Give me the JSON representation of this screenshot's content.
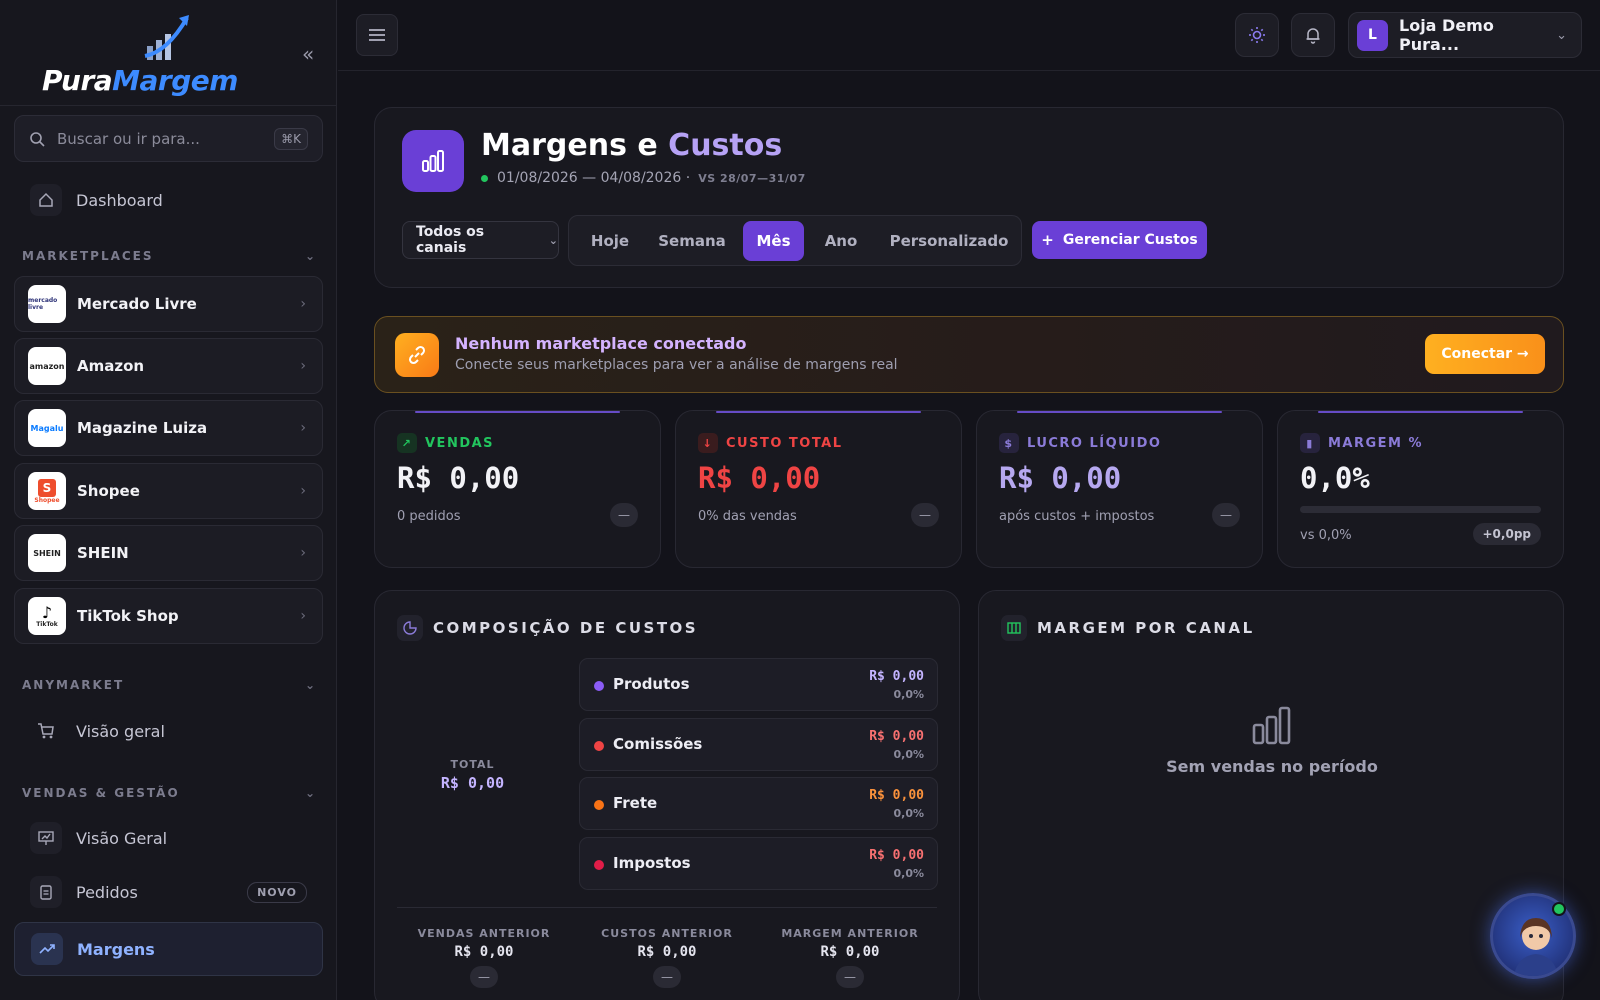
{
  "brand": {
    "part1": "Pura",
    "part2": "Margem"
  },
  "sidebar": {
    "search_placeholder": "Buscar ou ir para...",
    "search_shortcut": "⌘K",
    "dashboard": "Dashboard",
    "sections": {
      "marketplaces": "MARKETPLACES",
      "anymarket": "ANYMARKET",
      "vendas": "VENDAS & GESTÃO"
    },
    "marketplaces": [
      {
        "name": "Mercado Livre",
        "logo": "mercado livre"
      },
      {
        "name": "Amazon",
        "logo": "amazon"
      },
      {
        "name": "Magazine Luiza",
        "logo": "Magalu"
      },
      {
        "name": "Shopee",
        "logo": "Shopee"
      },
      {
        "name": "SHEIN",
        "logo": "SHEIN"
      },
      {
        "name": "TikTok Shop",
        "logo": "TikTok"
      }
    ],
    "anymarket_item": "Visão geral",
    "vendas_items": [
      {
        "label": "Visão Geral"
      },
      {
        "label": "Pedidos",
        "badge": "NOVO"
      }
    ],
    "active_item": "Margens"
  },
  "topbar": {
    "store_initial": "L",
    "store_name": "Loja Demo Pura..."
  },
  "header": {
    "title_main": "Margens e ",
    "title_accent": "Custos",
    "date_range": "01/08/2026 — 04/08/2026 ·",
    "compare": "VS 28/07—31/07",
    "channel_select": "Todos os canais",
    "tabs": [
      "Hoje",
      "Semana",
      "Mês",
      "Ano",
      "Personalizado"
    ],
    "selected_tab": "Mês",
    "manage_button": "Gerenciar Custos"
  },
  "alert": {
    "title": "Nenhum marketplace conectado",
    "text": "Conecte seus marketplaces para ver a análise de margens real",
    "button": "Conectar →"
  },
  "kpis": {
    "vendas": {
      "label": "VENDAS",
      "value": "R$ 0,00",
      "sub": "0 pedidos",
      "color": "#22c55e"
    },
    "custo": {
      "label": "CUSTO TOTAL",
      "value": "R$ 0,00",
      "sub": "0% das vendas",
      "color": "#ef4444"
    },
    "lucro": {
      "label": "LUCRO LÍQUIDO",
      "value": "R$ 0,00",
      "sub": "após custos + impostos",
      "color": "#8b7bd8"
    },
    "margem": {
      "label": "MARGEM %",
      "value": "0,0%",
      "sub": "vs 0,0%",
      "badge": "+0,0pp",
      "progress": 0,
      "color": "#8b7bd8"
    }
  },
  "composicao": {
    "title": "COMPOSIÇÃO DE CUSTOS",
    "total_label": "TOTAL",
    "total_value": "R$ 0,00",
    "rows": [
      {
        "name": "Produtos",
        "value": "R$ 0,00",
        "pct": "0,0%",
        "color": "#8b5cf6",
        "value_color": "#c4b4ff"
      },
      {
        "name": "Comissões",
        "value": "R$ 0,00",
        "pct": "0,0%",
        "color": "#ef4444",
        "value_color": "#f87171"
      },
      {
        "name": "Frete",
        "value": "R$ 0,00",
        "pct": "0,0%",
        "color": "#f97316",
        "value_color": "#fb923c"
      },
      {
        "name": "Impostos",
        "value": "R$ 0,00",
        "pct": "0,0%",
        "color": "#e11d48",
        "value_color": "#f87171"
      }
    ],
    "previous": [
      {
        "label": "VENDAS ANTERIOR",
        "value": "R$ 0,00"
      },
      {
        "label": "CUSTOS ANTERIOR",
        "value": "R$ 0,00"
      },
      {
        "label": "MARGEM ANTERIOR",
        "value": "R$ 0,00"
      }
    ]
  },
  "canal": {
    "title": "MARGEM POR CANAL",
    "empty": "Sem vendas no período"
  },
  "colors": {
    "accent": "#6a3fd6",
    "brand_blue": "#3d8bff",
    "warning": "#ffb020"
  },
  "icons": [
    "chart-logo-icon",
    "search-icon",
    "home-icon",
    "cart-icon",
    "presentation-chart-icon",
    "clipboard-icon",
    "trending-up-icon",
    "menu-icon",
    "sun-icon",
    "bell-icon",
    "bar-chart-icon",
    "link-icon",
    "pie-icon",
    "columns-icon"
  ]
}
